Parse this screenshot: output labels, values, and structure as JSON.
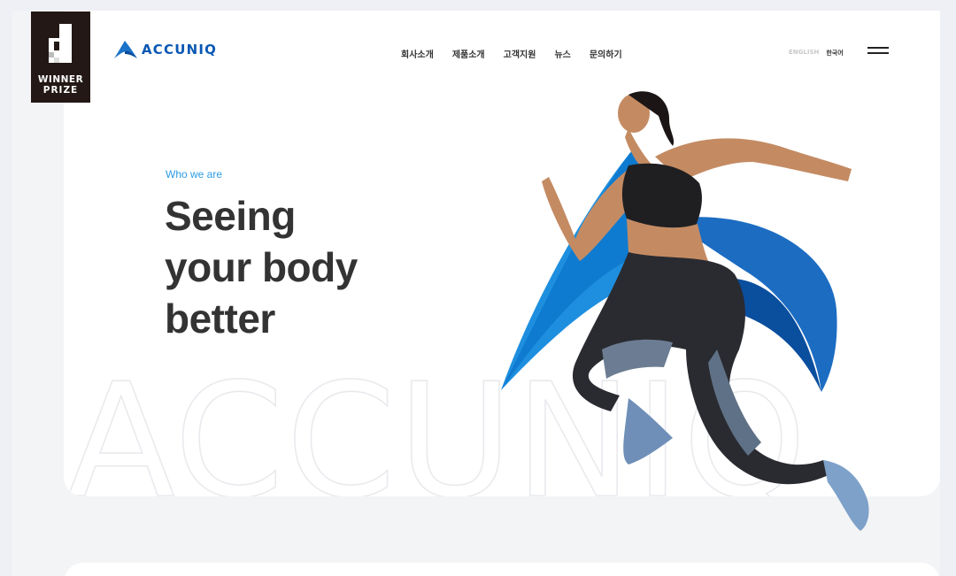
{
  "award": {
    "line1": "WINNER",
    "line2": "PRIZE",
    "icon": "award-d-logo-icon"
  },
  "brand": {
    "name": "ACCUNIQ",
    "color": "#0a58b4",
    "accent": "#2b9be3"
  },
  "nav": {
    "items": [
      {
        "label": "회사소개"
      },
      {
        "label": "제품소개"
      },
      {
        "label": "고객지원"
      },
      {
        "label": "뉴스"
      },
      {
        "label": "문의하기"
      }
    ]
  },
  "lang": {
    "english": "ENGLISH",
    "korean": "한국어"
  },
  "menu": {
    "icon": "hamburger-menu-icon"
  },
  "hero": {
    "eyebrow": "Who we are",
    "headline": [
      "Seeing",
      "your body",
      "better"
    ],
    "watermark": "ACCUNIQ",
    "image": "running-woman-illustration"
  }
}
